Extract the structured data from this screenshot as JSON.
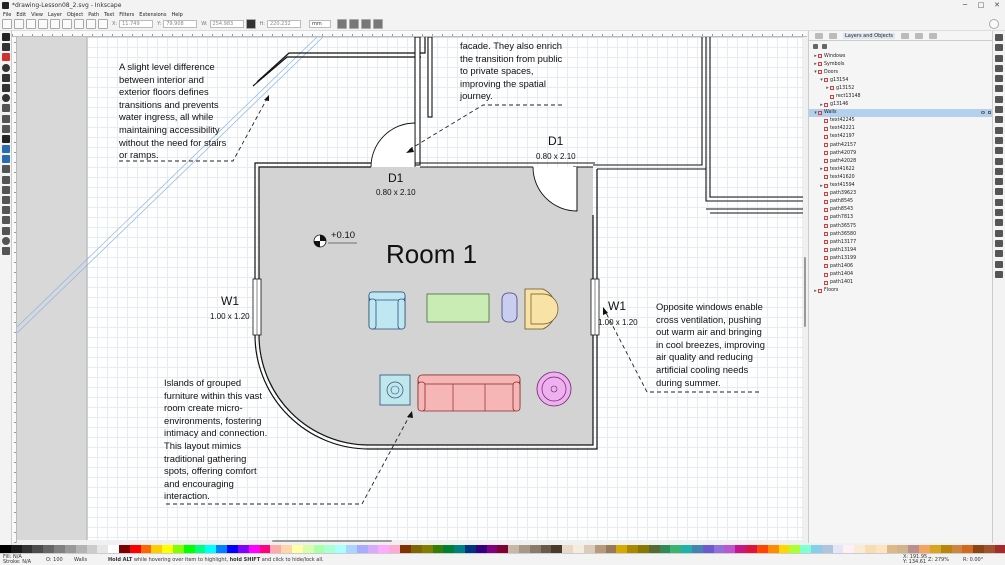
{
  "window": {
    "title": "*drawing-Lesson08_2.svg - Inkscape",
    "buttons": [
      "─",
      "□",
      "✕"
    ]
  },
  "menu": [
    "File",
    "Edit",
    "View",
    "Layer",
    "Object",
    "Path",
    "Text",
    "Filters",
    "Extensions",
    "Help"
  ],
  "toolbar": {
    "x_label": "X:",
    "x_value": "11.749",
    "y_label": "Y:",
    "y_value": "79.908",
    "w_label": "W:",
    "w_value": "254.983",
    "h_label": "H:",
    "h_value": "220.232",
    "unit": "mm"
  },
  "panel": {
    "tab_label": "Layers and Objects",
    "tree": [
      {
        "label": "Windows",
        "depth": 0,
        "exp": "▸",
        "sel": false
      },
      {
        "label": "Symbols",
        "depth": 0,
        "exp": "▸",
        "sel": false
      },
      {
        "label": "Doors",
        "depth": 0,
        "exp": "▾",
        "sel": false
      },
      {
        "label": "g13154",
        "depth": 1,
        "exp": "▾",
        "sel": false
      },
      {
        "label": "g13152",
        "depth": 2,
        "exp": "▸",
        "sel": false
      },
      {
        "label": "rect13148",
        "depth": 2,
        "exp": "",
        "sel": false
      },
      {
        "label": "g13146",
        "depth": 1,
        "exp": "▸",
        "sel": false
      },
      {
        "label": "Walls",
        "depth": 0,
        "exp": "▾",
        "sel": true
      },
      {
        "label": "text42245",
        "depth": 1,
        "exp": "",
        "sel": false
      },
      {
        "label": "text42221",
        "depth": 1,
        "exp": "",
        "sel": false
      },
      {
        "label": "text42197",
        "depth": 1,
        "exp": "",
        "sel": false
      },
      {
        "label": "path42157",
        "depth": 1,
        "exp": "",
        "sel": false
      },
      {
        "label": "path42079",
        "depth": 1,
        "exp": "",
        "sel": false
      },
      {
        "label": "path42028",
        "depth": 1,
        "exp": "",
        "sel": false
      },
      {
        "label": "text41622",
        "depth": 1,
        "exp": "▸",
        "sel": false
      },
      {
        "label": "text41620",
        "depth": 1,
        "exp": "",
        "sel": false
      },
      {
        "label": "text41594",
        "depth": 1,
        "exp": "▸",
        "sel": false
      },
      {
        "label": "path39623",
        "depth": 1,
        "exp": "",
        "sel": false
      },
      {
        "label": "path8545",
        "depth": 1,
        "exp": "",
        "sel": false
      },
      {
        "label": "path8543",
        "depth": 1,
        "exp": "",
        "sel": false
      },
      {
        "label": "path7813",
        "depth": 1,
        "exp": "",
        "sel": false
      },
      {
        "label": "path36575",
        "depth": 1,
        "exp": "",
        "sel": false
      },
      {
        "label": "path36580",
        "depth": 1,
        "exp": "",
        "sel": false
      },
      {
        "label": "path13177",
        "depth": 1,
        "exp": "",
        "sel": false
      },
      {
        "label": "path13194",
        "depth": 1,
        "exp": "",
        "sel": false
      },
      {
        "label": "path13199",
        "depth": 1,
        "exp": "",
        "sel": false
      },
      {
        "label": "path1406",
        "depth": 1,
        "exp": "",
        "sel": false
      },
      {
        "label": "path1404",
        "depth": 1,
        "exp": "",
        "sel": false
      },
      {
        "label": "path1401",
        "depth": 1,
        "exp": "",
        "sel": false
      },
      {
        "label": "Floors",
        "depth": 0,
        "exp": "▸",
        "sel": false
      }
    ]
  },
  "drawing": {
    "note_top_left": "A slight level difference\nbetween interior and\nexterior floors defines\ntransitions and prevents\nwater ingress, all while\nmaintaining accessibility\nwithout the need for stairs\nor ramps.",
    "note_top_center": "facade. They also enrich\nthe transition from public\nto private spaces,\nimproving the spatial\njourney.",
    "note_right": "Opposite windows enable\ncross ventilation, pushing\nout warm air and bringing\nin cool breezes, improving\nair quality and reducing\nartificial cooling needs\nduring summer.",
    "note_bottom_left": "Islands of grouped\nfurniture within this vast\nroom create micro-\nenvironments, fostering\nintimacy and connection.\nThis layout mimics\ntraditional gathering\nspots, offering comfort\nand encouraging\ninteraction.",
    "room_label": "Room 1",
    "level": "+0.10",
    "d1_left": "D1",
    "d1_left_dim": "0.80 x 2.10",
    "d1_right": "D1",
    "d1_right_dim": "0.80 x 2.10",
    "w1_left": "W1",
    "w1_left_dim": "1.00 x 1.20",
    "w1_right": "W1",
    "w1_right_dim": "1.00 x 1.20"
  },
  "status": {
    "fill_label": "Fill:",
    "fill_value": "N/A",
    "stroke_label": "Stroke:",
    "stroke_value": "N/A",
    "opacity_label": "O:",
    "opacity_value": "100",
    "layer": "Walls",
    "hint_bold1": "Hold ALT",
    "hint_mid": " while hovering over item to highlight, ",
    "hint_bold2": "hold SHIFT",
    "hint_end": " and click to hide/lock all.",
    "x_coord": "X: 191.95",
    "y_coord": "Y: 134.61",
    "zoom": "Z: 279%",
    "rotation": "R: 0.00°"
  },
  "colors": {
    "room_fill": "#d3d3d3",
    "selection": "#b3d1ee",
    "armchair": "#bfe7f2",
    "table": "#c9ecb4",
    "sofa": "#f7b6b6",
    "ottoman": "#c9cdf0",
    "chair": "#f8e2a6",
    "stool": "#efb0ef",
    "side_table": "#bfe7ec"
  }
}
